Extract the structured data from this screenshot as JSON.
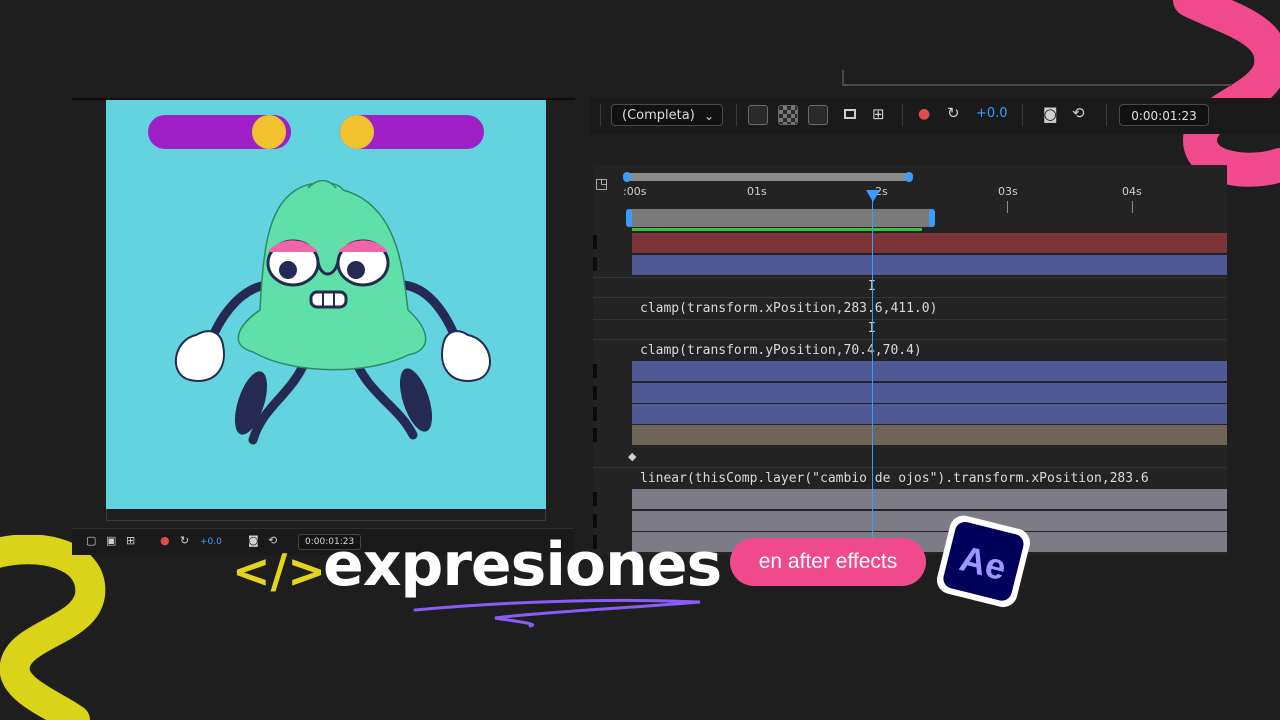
{
  "viewer": {
    "toolbar": {
      "exposure": "+0.0",
      "timecode": "0:00:01:23"
    },
    "toggle_left": {
      "track_color": "#a020c8",
      "knob_color": "#f2c12e"
    },
    "toggle_right": {
      "track_color": "#a020c8",
      "knob_color": "#f2c12e"
    },
    "background_color": "#62d3df",
    "character_color": "#5ee0a8"
  },
  "ae_toolbar": {
    "resolution": "(Completa)",
    "exposure": "+0.0",
    "timecode": "0:00:01:23"
  },
  "timeline": {
    "ruler": [
      ":00s",
      "01s",
      "2s",
      "03s",
      "04s"
    ],
    "expressions": [
      "clamp(transform.xPosition,283.6,411.0)",
      "clamp(transform.yPosition,70.4,70.4)",
      "linear(thisComp.layer(\"cambio de ojos\").transform.xPosition,283.6"
    ],
    "cursor_glyph": "I",
    "layer_colors": [
      "#7b3338",
      "#4f5a94",
      "#4f5a94",
      "#4f5a94",
      "#4f5a94",
      "#6e6457",
      "#7c7b86",
      "#7c7b86",
      "#7c7b86"
    ]
  },
  "title": {
    "code_glyph": "</>",
    "word": "expresiones",
    "pill": "en after effects",
    "logo_text": "Ae"
  },
  "colors": {
    "accent_yellow": "#e4d51c",
    "accent_pink": "#f04a8c",
    "ae_blue": "#00005b",
    "ae_purple": "#9999ff",
    "scribble_purple": "#8b5cf6"
  }
}
